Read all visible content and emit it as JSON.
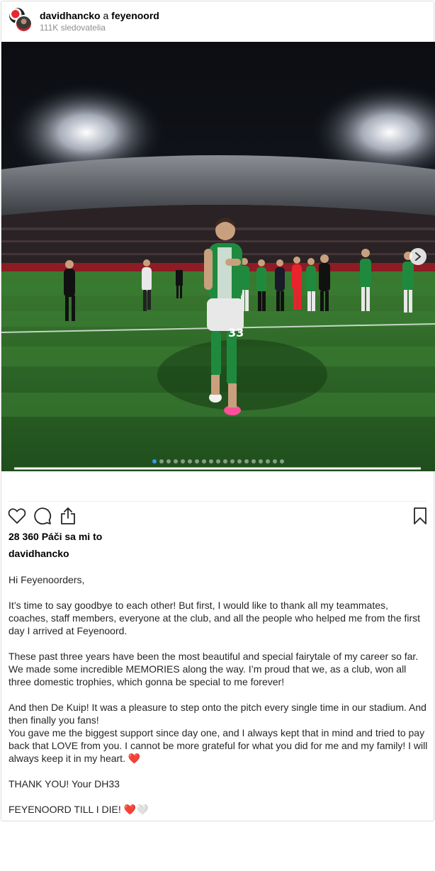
{
  "header": {
    "username": "davidhancko",
    "connector": "a",
    "collab": "feyenoord",
    "followers": "111K sledovatelia"
  },
  "carousel": {
    "slide_count": 19,
    "active_index": 0,
    "jersey_number": "33"
  },
  "actions": {
    "like_icon": "heart-outline-icon",
    "comment_icon": "comment-bubble-icon",
    "share_icon": "share-upload-icon",
    "save_icon": "bookmark-icon"
  },
  "likes": "28 360 Páči sa mi to",
  "author": "davidhancko",
  "caption": {
    "p1": "Hi Feyenoorders,",
    "p2": "It’s time to say goodbye to each other! But first, I would like to thank all my teammates, coaches, staff members, everyone at the club, and all the people who helped me from the first day I arrived at Feyenoord.",
    "p3": "These past three years have been the most beautiful and special fairytale of my career so far. We made some incredible MEMORIES along the way. I’m proud that we, as a club, won all three domestic trophies, which gonna be special to me forever!",
    "p4": "And then De Kuip! It was a pleasure to step onto the pitch every single time in our stadium. And then finally you fans!\nYou gave me the biggest support since day one, and I always kept that in mind and tried to pay back that LOVE from you. I cannot be more grateful for what you did for me and my family! I will always keep it in my heart.",
    "p4_emoji": "❤️",
    "p5": "THANK YOU! Your DH33",
    "p6": "FEYENOORD TILL I DIE!",
    "p6_emoji_red": "❤️",
    "p6_emoji_white": "🤍"
  },
  "colors": {
    "pitch": "#2f6a2a",
    "kit_green": "#1f8a3e",
    "link_blue": "#3897f0"
  }
}
